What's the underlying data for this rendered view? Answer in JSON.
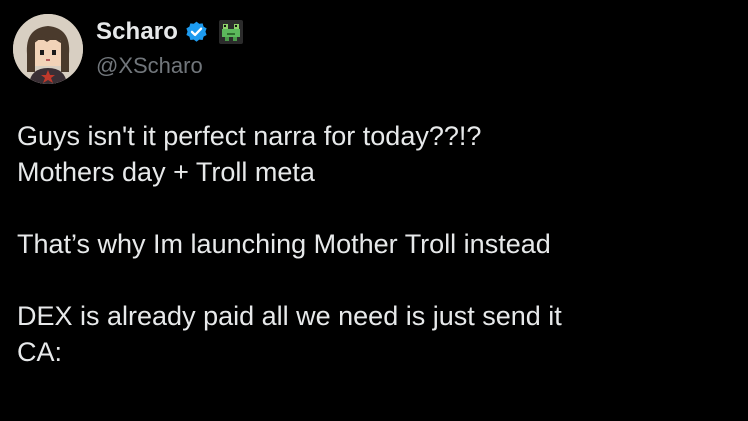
{
  "author": {
    "display_name": "Scharo",
    "handle": "@XScharo",
    "verified_icon": "verified-badge-icon",
    "affiliation_icon": "frog-icon"
  },
  "post": {
    "lines": [
      "Guys isn't it perfect narra for today??!?",
      "Mothers day + Troll meta",
      "That’s why Im launching Mother Troll instead",
      "DEX is already paid all we need is just send it",
      "CA:"
    ]
  },
  "colors": {
    "background": "#000000",
    "text": "#e7e9ea",
    "secondary_text": "#71767b",
    "verified_blue": "#1d9bf0",
    "frog_green": "#5cb85c"
  }
}
